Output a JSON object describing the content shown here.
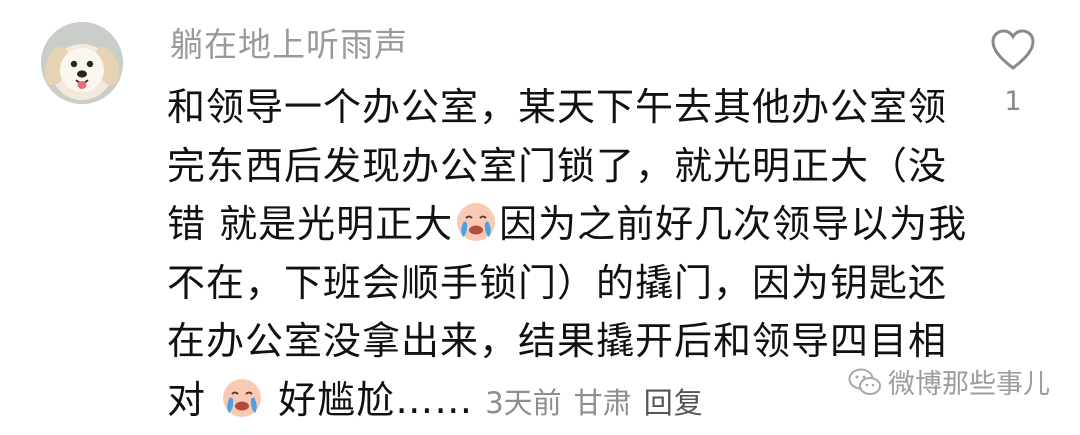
{
  "comment": {
    "username": "躺在地上听雨声",
    "lines": [
      "和领导一个办公室，某天下午去其他办公室领",
      "完东西后发现办公室门锁了，就光明正大（没",
      "错 就是光明正大",
      "因为之前好几次领导以为我",
      "不在，下班会顺手锁门）的撬门，因为钥匙还",
      "在办公室没拿出来，结果撬开后和领导四目相",
      "对",
      "好尴尬……"
    ],
    "time": "3天前",
    "location": "甘肃",
    "reply_label": "回复",
    "like_count": "1",
    "emoji": "crying-laughing-emoji"
  },
  "watermark": {
    "text": "微博那些事儿",
    "icon": "wechat-icon"
  },
  "colors": {
    "username": "#9a9a9a",
    "body": "#111111",
    "meta": "#8e8e8e"
  }
}
